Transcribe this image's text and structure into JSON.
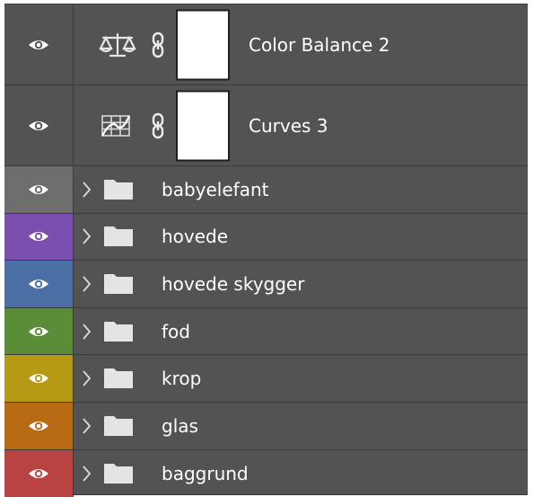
{
  "layers": [
    {
      "type": "adjustment",
      "name": "Color Balance 2",
      "icon": "color-balance-icon",
      "visible": true
    },
    {
      "type": "adjustment",
      "name": "Curves 3",
      "icon": "curves-icon",
      "visible": true
    },
    {
      "type": "group",
      "name": "babyelefant",
      "color": "#6e6e6e",
      "visible": true
    },
    {
      "type": "group",
      "name": "hovede",
      "color": "#7a4fad",
      "visible": true
    },
    {
      "type": "group",
      "name": "hovede skygger",
      "color": "#4a6fa4",
      "visible": true
    },
    {
      "type": "group",
      "name": "fod",
      "color": "#5a8d38",
      "visible": true
    },
    {
      "type": "group",
      "name": "krop",
      "color": "#b69a15",
      "visible": true
    },
    {
      "type": "group",
      "name": "glas",
      "color": "#b86a15",
      "visible": true
    },
    {
      "type": "group",
      "name": "baggrund",
      "color": "#b94343",
      "visible": true
    }
  ]
}
